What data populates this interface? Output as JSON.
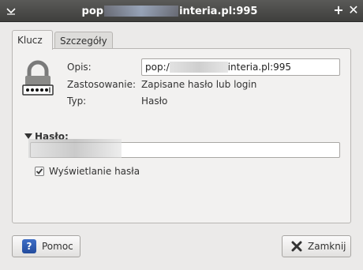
{
  "window": {
    "title_prefix": "pop",
    "title_suffix": "interia.pl:995"
  },
  "tabs": [
    {
      "label": "Klucz",
      "active": true
    },
    {
      "label": "Szczegóły",
      "active": false
    }
  ],
  "details": {
    "description_label": "Opis:",
    "description_value_prefix": "pop:/",
    "description_value_suffix": "interia.pl:995",
    "usage_label": "Zastosowanie:",
    "usage_value": "Zapisane hasło lub login",
    "type_label": "Typ:",
    "type_value": "Hasło"
  },
  "password": {
    "header": "Hasło:",
    "show_password_label": "Wyświetlanie hasła",
    "show_password_checked": true
  },
  "buttons": {
    "help": "Pomoc",
    "close": "Zamknij"
  },
  "icons": {
    "window_menu": "chevron-down-icon",
    "maximize": "plus-icon",
    "close": "close-icon",
    "lock": "lock-icon",
    "help": "help-icon",
    "dialog_close": "x-icon"
  }
}
